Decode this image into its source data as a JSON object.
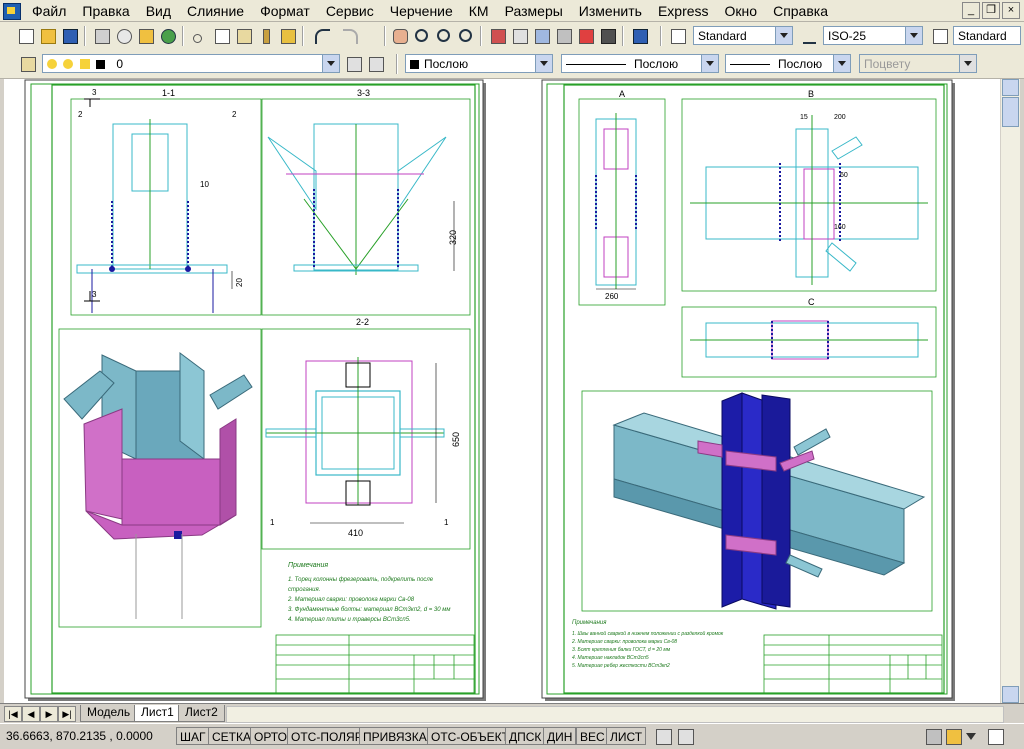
{
  "menu": {
    "items": [
      "Файл",
      "Правка",
      "Вид",
      "Слияние",
      "Формат",
      "Сервис",
      "Черчение",
      "КМ",
      "Размеры",
      "Изменить",
      "Express",
      "Окно",
      "Справка"
    ]
  },
  "window_controls": {
    "minimize": "_",
    "restore": "❐",
    "close": "×"
  },
  "toolbar": {
    "text_style": "Standard",
    "dim_style": "ISO-25",
    "table_style": "Standard"
  },
  "layers": {
    "current_layer": "0",
    "color": "Послою",
    "linetype": "Послою",
    "lineweight": "Послою",
    "plot_style": "Поцвету"
  },
  "tabs": [
    "Модель",
    "Лист1",
    "Лист2"
  ],
  "active_tab": "Лист1",
  "status": {
    "coords": "36.6663,  870.2135 , 0.0000",
    "buttons": [
      "ШАГ",
      "СЕТКА",
      "ОРТО",
      "ОТС-ПОЛЯР",
      "ПРИВЯЗКА",
      "ОТС-ОБЪЕКТ",
      "ДПСК",
      "ДИН",
      "ВЕС",
      "ЛИСТ"
    ]
  },
  "drawing": {
    "sheet1": {
      "view_11": "1-1",
      "view_33": "3-3",
      "view_22": "2-2",
      "cut_2": "2",
      "cut_3": "3",
      "dim_10": "10",
      "dim_20": "20",
      "dim_320": "320",
      "dim_650": "650",
      "dim_410": "410",
      "cut_1": "1",
      "notes_title": "Примечания",
      "notes": [
        "1. Торец колонны фрезеровать, подкрепить после",
        "строгания.",
        "2. Материал сварки: проволока марки Св-08",
        "3. Фундаментные болты: материал ВСт3кп2, d = 30 мм",
        "4. Материал плиты и траверсы ВСт3сп5."
      ]
    },
    "sheet2": {
      "view_a": "A",
      "view_b": "B",
      "view_c": "C",
      "dim_260": "260",
      "dim_200": "200",
      "dim_15": "15",
      "dim_60": "60",
      "dim_160": "160",
      "notes_title": "Примечания",
      "notes": [
        "1. Швы ванной сваркой в нижнем положении с разделкой кромок",
        "2. Материал сварки: проволока марки Св-08",
        "3. Болт крепления балки ГОСТ, d = 20 мм",
        "4. Материал накладок ВСт3сп5",
        "5. Материал ребер жесткости ВСт3кп2"
      ]
    }
  }
}
